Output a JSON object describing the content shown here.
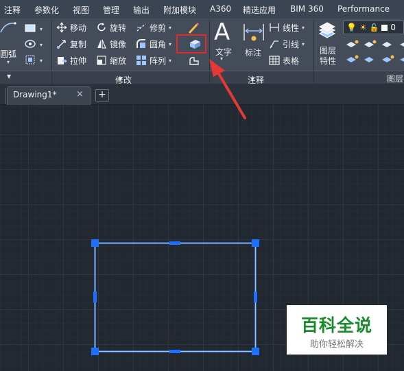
{
  "menu": [
    "注释",
    "参数化",
    "视图",
    "管理",
    "输出",
    "附加模块",
    "A360",
    "精选应用",
    "BIM 360",
    "Performance"
  ],
  "draw_panel": {
    "arc_label": "圆弧"
  },
  "modify_panel": {
    "title": "修改",
    "tools": {
      "move": "移动",
      "rotate": "旋转",
      "trim": "修剪",
      "copy": "复制",
      "mirror": "镜像",
      "fillet": "圆角",
      "stretch": "拉伸",
      "scale": "缩放",
      "array": "阵列"
    }
  },
  "annotation_panel": {
    "title": "注释",
    "text": "文字",
    "dimension": "标注",
    "linear": "线性",
    "leader": "引线",
    "table": "表格"
  },
  "layers_panel": {
    "title": "图层",
    "layer_properties": "图层\n特性",
    "layer_value": "0"
  },
  "tab": {
    "name": "Drawing1*",
    "close": "×",
    "new": "+"
  },
  "highlight": {
    "color": "#e02b2b",
    "target": "modify-extra-tool"
  },
  "watermark": {
    "title": "百科全说",
    "subtitle": "助你轻松解决"
  },
  "colors": {
    "selection": "#4a90ff",
    "ribbon": "#444c59",
    "canvas": "#212830"
  }
}
